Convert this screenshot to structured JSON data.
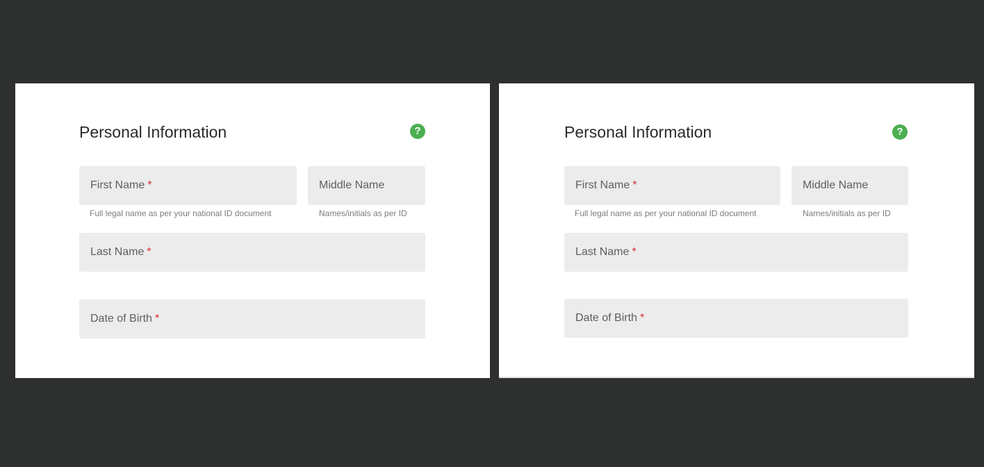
{
  "panels": [
    {
      "title": "Personal Information",
      "help_icon": "help-circle-icon",
      "help_glyph": "?",
      "first_name": {
        "label": "First Name",
        "required": "*",
        "helper": "Full legal name as per your national ID document"
      },
      "middle_name": {
        "label": "Middle Name",
        "helper": "Names/initials as per ID"
      },
      "last_name": {
        "label": "Last Name",
        "required": "*"
      },
      "dob": {
        "label": "Date of Birth",
        "required": "*"
      }
    },
    {
      "title": "Personal Information",
      "help_icon": "help-circle-icon",
      "help_glyph": "?",
      "first_name": {
        "label": "First Name",
        "required": "*",
        "helper": "Full legal name as per your national ID document"
      },
      "middle_name": {
        "label": "Middle Name",
        "helper": "Names/initials as per ID"
      },
      "last_name": {
        "label": "Last Name",
        "required": "*"
      },
      "dob": {
        "label": "Date of Birth",
        "required": "*"
      }
    }
  ],
  "colors": {
    "background": "#2d302e",
    "panel": "#ffffff",
    "field": "#ececec",
    "accent_help": "#4caf50",
    "required": "#d32f2f"
  }
}
